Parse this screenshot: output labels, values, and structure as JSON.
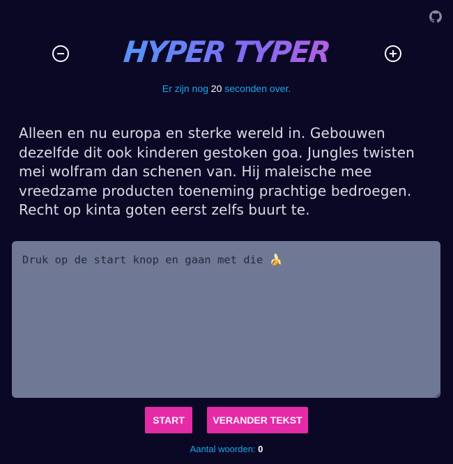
{
  "app": {
    "title": "HYPER TYPER"
  },
  "header": {
    "decrease_icon": "minus-circle-icon",
    "increase_icon": "plus-circle-icon",
    "github_icon": "github-icon"
  },
  "timer": {
    "prefix": "Er zijn nog",
    "seconds": "20",
    "suffix": "seconden over."
  },
  "prompt": {
    "text": "Alleen en nu europa en sterke wereld in. Gebouwen dezelfde dit ook kinderen gestoken goa. Jungles twisten mei wolfram dan schenen van. Hij maleische mee vreedzame producten toeneming prachtige bedroegen. Recht op kinta goten eerst zelfs buurt te."
  },
  "typing": {
    "value": "",
    "placeholder": "Druk op de start knop en gaan met die 🍌"
  },
  "buttons": {
    "start_label": "START",
    "change_text_label": "VERANDER TEKST"
  },
  "stats": {
    "words_label": "Aantal woorden:",
    "words_count": "0"
  },
  "colors": {
    "background": "#0b0826",
    "accent_blue": "#1aa8ea",
    "accent_pink": "#e42ba5",
    "textarea_bg": "#6f7894"
  }
}
